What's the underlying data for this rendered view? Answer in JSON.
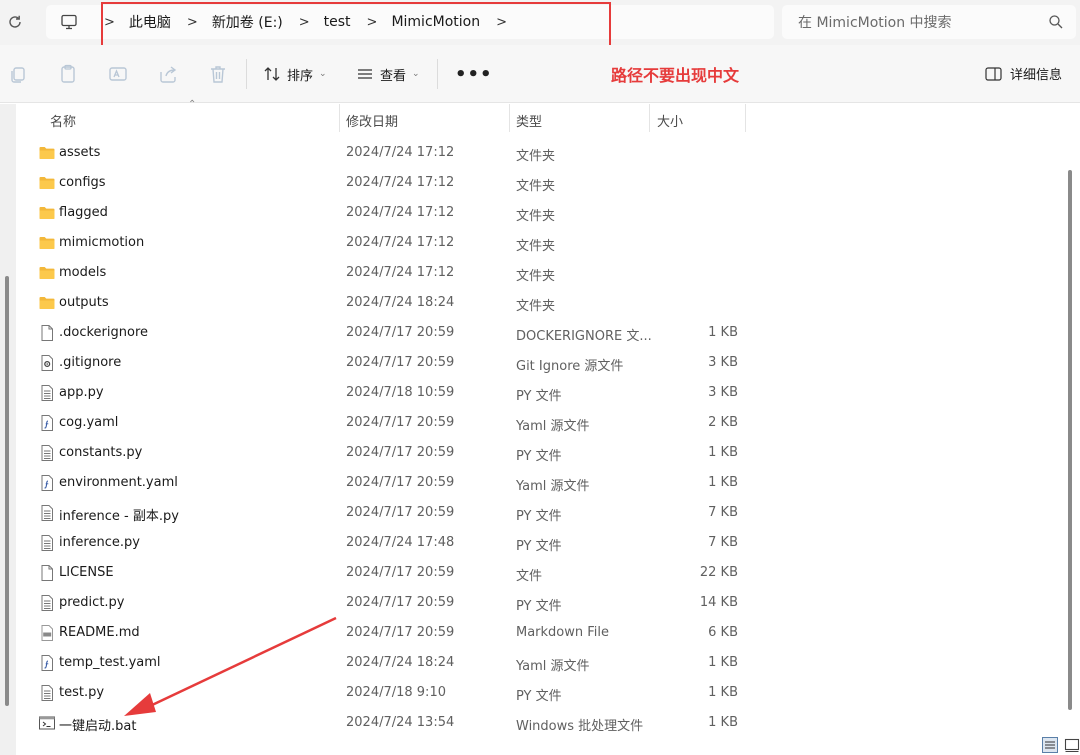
{
  "address": {
    "crumbs": [
      "此电脑",
      "新加卷 (E:)",
      "test",
      "MimicMotion"
    ]
  },
  "search": {
    "placeholder": "在 MimicMotion 中搜索"
  },
  "toolbar": {
    "sort_label": "排序",
    "view_label": "查看",
    "more_label": "•••",
    "details_label": "详细信息"
  },
  "annotation": {
    "note": "路径不要出现中文",
    "color": "#e63b3b"
  },
  "columns": {
    "name": "名称",
    "date": "修改日期",
    "type": "类型",
    "size": "大小"
  },
  "files": [
    {
      "name": "assets",
      "date": "2024/7/24 17:12",
      "type": "文件夹",
      "size": "",
      "icon": "folder-icon"
    },
    {
      "name": "configs",
      "date": "2024/7/24 17:12",
      "type": "文件夹",
      "size": "",
      "icon": "folder-icon"
    },
    {
      "name": "flagged",
      "date": "2024/7/24 17:12",
      "type": "文件夹",
      "size": "",
      "icon": "folder-icon"
    },
    {
      "name": "mimicmotion",
      "date": "2024/7/24 17:12",
      "type": "文件夹",
      "size": "",
      "icon": "folder-icon"
    },
    {
      "name": "models",
      "date": "2024/7/24 17:12",
      "type": "文件夹",
      "size": "",
      "icon": "folder-icon"
    },
    {
      "name": "outputs",
      "date": "2024/7/24 18:24",
      "type": "文件夹",
      "size": "",
      "icon": "folder-icon"
    },
    {
      "name": ".dockerignore",
      "date": "2024/7/17 20:59",
      "type": "DOCKERIGNORE 文...",
      "size": "1 KB",
      "icon": "blank-file-icon"
    },
    {
      "name": ".gitignore",
      "date": "2024/7/17 20:59",
      "type": "Git Ignore 源文件",
      "size": "3 KB",
      "icon": "gear-file-icon"
    },
    {
      "name": "app.py",
      "date": "2024/7/18 10:59",
      "type": "PY 文件",
      "size": "3 KB",
      "icon": "text-file-icon"
    },
    {
      "name": "cog.yaml",
      "date": "2024/7/17 20:59",
      "type": "Yaml 源文件",
      "size": "2 KB",
      "icon": "script-file-icon"
    },
    {
      "name": "constants.py",
      "date": "2024/7/17 20:59",
      "type": "PY 文件",
      "size": "1 KB",
      "icon": "text-file-icon"
    },
    {
      "name": "environment.yaml",
      "date": "2024/7/17 20:59",
      "type": "Yaml 源文件",
      "size": "1 KB",
      "icon": "script-file-icon"
    },
    {
      "name": "inference - 副本.py",
      "date": "2024/7/17 20:59",
      "type": "PY 文件",
      "size": "7 KB",
      "icon": "text-file-icon"
    },
    {
      "name": "inference.py",
      "date": "2024/7/24 17:48",
      "type": "PY 文件",
      "size": "7 KB",
      "icon": "text-file-icon"
    },
    {
      "name": "LICENSE",
      "date": "2024/7/17 20:59",
      "type": "文件",
      "size": "22 KB",
      "icon": "blank-file-icon"
    },
    {
      "name": "predict.py",
      "date": "2024/7/17 20:59",
      "type": "PY 文件",
      "size": "14 KB",
      "icon": "text-file-icon"
    },
    {
      "name": "README.md",
      "date": "2024/7/17 20:59",
      "type": "Markdown File",
      "size": "6 KB",
      "icon": "markdown-file-icon"
    },
    {
      "name": "temp_test.yaml",
      "date": "2024/7/24 18:24",
      "type": "Yaml 源文件",
      "size": "1 KB",
      "icon": "script-file-icon"
    },
    {
      "name": "test.py",
      "date": "2024/7/18 9:10",
      "type": "PY 文件",
      "size": "1 KB",
      "icon": "text-file-icon"
    },
    {
      "name": "一键启动.bat",
      "date": "2024/7/24 13:54",
      "type": "Windows 批处理文件",
      "size": "1 KB",
      "icon": "batch-file-icon"
    }
  ]
}
